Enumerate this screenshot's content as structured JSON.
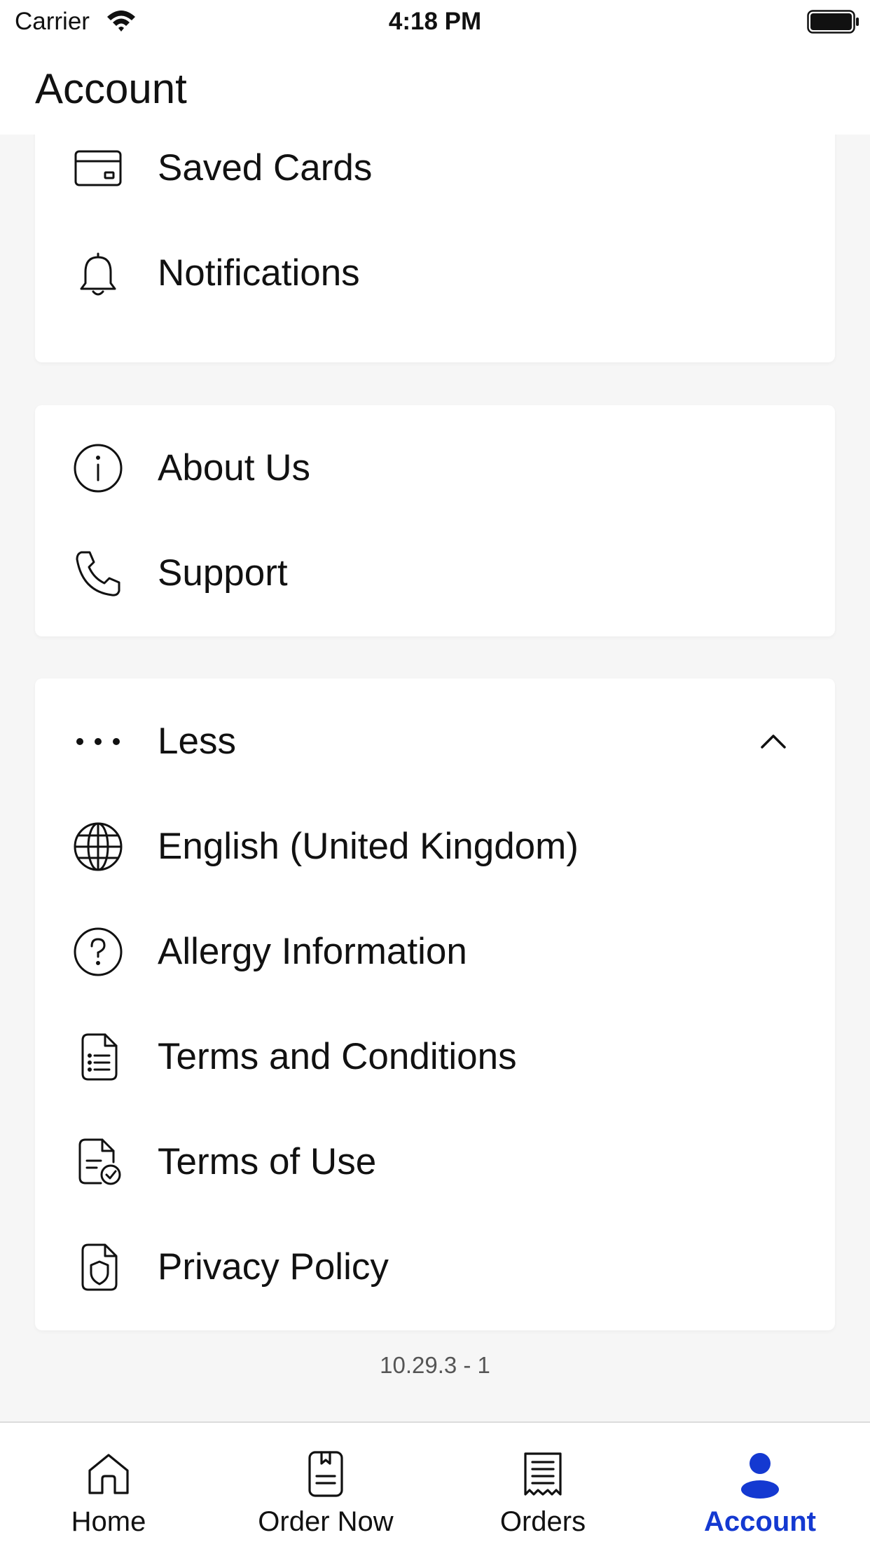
{
  "status_bar": {
    "carrier": "Carrier",
    "time": "4:18 PM"
  },
  "header": {
    "title": "Account"
  },
  "groups": [
    {
      "items": [
        {
          "label": "Saved Cards",
          "icon": "credit-card-icon"
        },
        {
          "label": "Notifications",
          "icon": "bell-icon"
        }
      ]
    },
    {
      "items": [
        {
          "label": "About Us",
          "icon": "info-icon"
        },
        {
          "label": "Support",
          "icon": "phone-icon"
        }
      ]
    },
    {
      "items": [
        {
          "label": "Less",
          "icon": "more-dots-icon",
          "trailing_icon": "chevron-up-icon"
        },
        {
          "label": "English (United Kingdom)",
          "icon": "globe-icon"
        },
        {
          "label": "Allergy Information",
          "icon": "question-icon"
        },
        {
          "label": "Terms and Conditions",
          "icon": "document-list-icon"
        },
        {
          "label": "Terms of Use",
          "icon": "document-check-icon"
        },
        {
          "label": "Privacy Policy",
          "icon": "document-shield-icon"
        }
      ]
    }
  ],
  "version": "10.29.3 - 1",
  "tab_bar": {
    "tabs": [
      {
        "label": "Home",
        "icon": "home-icon",
        "active": false
      },
      {
        "label": "Order Now",
        "icon": "order-menu-icon",
        "active": false
      },
      {
        "label": "Orders",
        "icon": "receipt-icon",
        "active": false
      },
      {
        "label": "Account",
        "icon": "person-icon",
        "active": true
      }
    ]
  },
  "colors": {
    "accent": "#1439d1",
    "background": "#f6f6f6",
    "card": "#ffffff",
    "text": "#111111"
  }
}
